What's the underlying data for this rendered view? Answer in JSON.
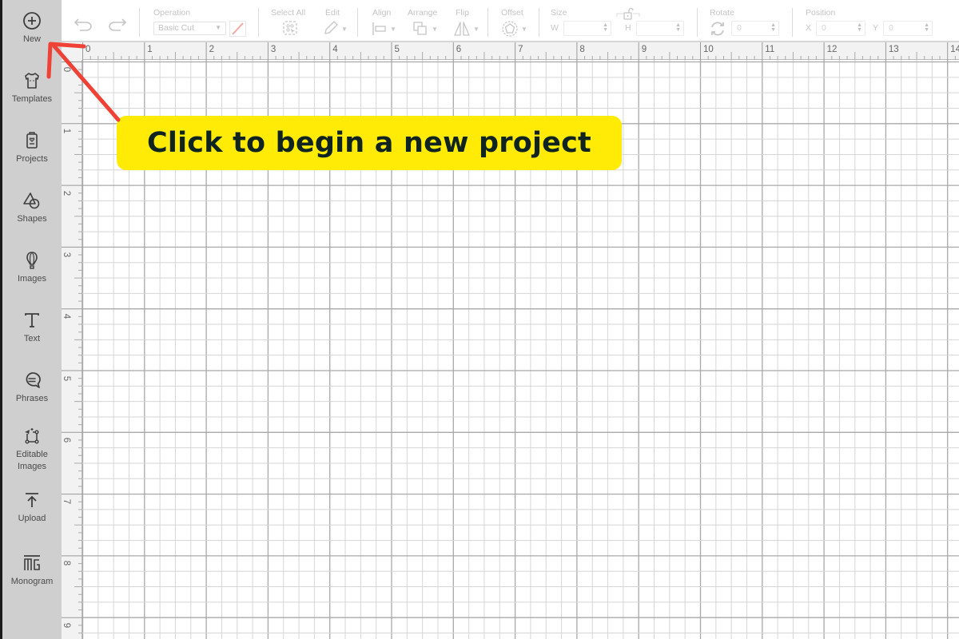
{
  "sidebar": {
    "items": [
      {
        "label": "New",
        "icon": "plus-circle-icon"
      },
      {
        "label": "Templates",
        "icon": "tshirt-icon"
      },
      {
        "label": "Projects",
        "icon": "projects-icon"
      },
      {
        "label": "Shapes",
        "icon": "shapes-icon"
      },
      {
        "label": "Images",
        "icon": "balloon-icon"
      },
      {
        "label": "Text",
        "icon": "text-icon"
      },
      {
        "label": "Phrases",
        "icon": "speech-bubble-icon"
      },
      {
        "label": "Editable Images",
        "icon": "editable-images-icon"
      },
      {
        "label": "Upload",
        "icon": "upload-icon"
      },
      {
        "label": "Monogram",
        "icon": "monogram-icon"
      }
    ]
  },
  "toolbar": {
    "undo_icon": "undo-icon",
    "redo_icon": "redo-icon",
    "operation_label": "Operation",
    "operation_value": "Basic Cut",
    "select_all_label": "Select All",
    "edit_label": "Edit",
    "align_label": "Align",
    "arrange_label": "Arrange",
    "flip_label": "Flip",
    "offset_label": "Offset",
    "size_label": "Size",
    "width_label": "W",
    "height_label": "H",
    "width_value": "",
    "height_value": "",
    "rotate_label": "Rotate",
    "rotate_value": "0",
    "position_label": "Position",
    "x_label": "X",
    "x_value": "0",
    "y_label": "Y",
    "y_value": "0"
  },
  "rulers": {
    "horizontal": [
      "0",
      "1",
      "2",
      "3",
      "4",
      "5",
      "6",
      "7",
      "8",
      "9",
      "10",
      "11",
      "12",
      "13",
      "14"
    ],
    "vertical": [
      "0",
      "1",
      "2",
      "3",
      "4",
      "5",
      "6",
      "7",
      "8",
      "9"
    ],
    "unit": "inch"
  },
  "annotation": {
    "callout_text": "Click to begin a new project",
    "callout_color": "#ffeb05",
    "arrow_color": "#ef4136",
    "arrow_target": "New"
  }
}
